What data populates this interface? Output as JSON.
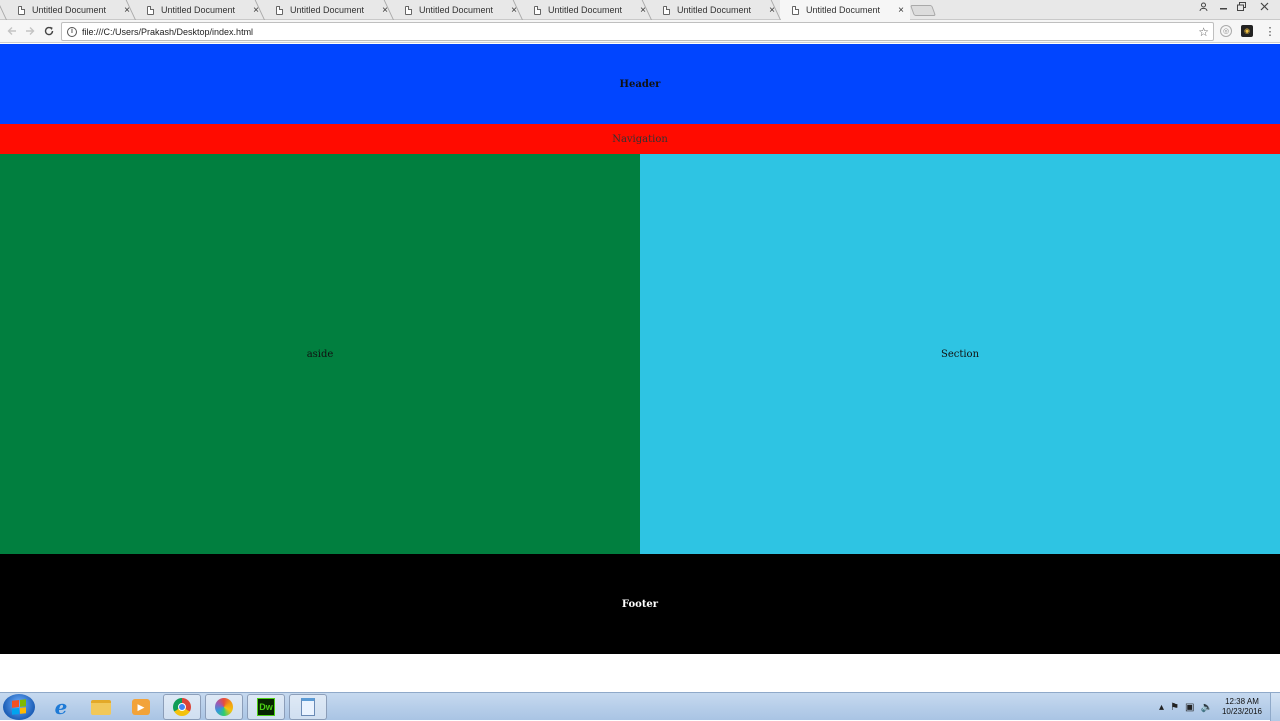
{
  "browser": {
    "tabs": [
      {
        "title": "Untitled Document"
      },
      {
        "title": "Untitled Document"
      },
      {
        "title": "Untitled Document"
      },
      {
        "title": "Untitled Document"
      },
      {
        "title": "Untitled Document"
      },
      {
        "title": "Untitled Document"
      },
      {
        "title": "Untitled Document",
        "active": true
      }
    ],
    "tab_close_glyph": "×",
    "url": "file:///C:/Users/Prakash/Desktop/index.html",
    "icons": {
      "back": "back-arrow-icon",
      "forward": "forward-arrow-icon",
      "reload": "reload-icon",
      "info": "page-info-icon",
      "bookmark": "star-icon",
      "menu": "menu-kebab-icon"
    }
  },
  "page": {
    "header": {
      "text": "Header",
      "color": "#0145ff"
    },
    "navigation": {
      "text": "Navigation",
      "color": "#ff0b00"
    },
    "aside": {
      "text": "aside",
      "color": "#017f3f"
    },
    "section": {
      "text": "Section",
      "color": "#2ec4e3"
    },
    "footer": {
      "text": "Footer",
      "color": "#000000"
    }
  },
  "taskbar": {
    "apps": [
      "start-icon",
      "internet-explorer-icon",
      "file-explorer-icon",
      "media-player-icon",
      "chrome-icon",
      "photo-viewer-icon",
      "dreamweaver-icon",
      "notepad-icon"
    ],
    "dw_label": "Dw",
    "clock": {
      "time": "12:38 AM",
      "date": "10/23/2016"
    }
  }
}
